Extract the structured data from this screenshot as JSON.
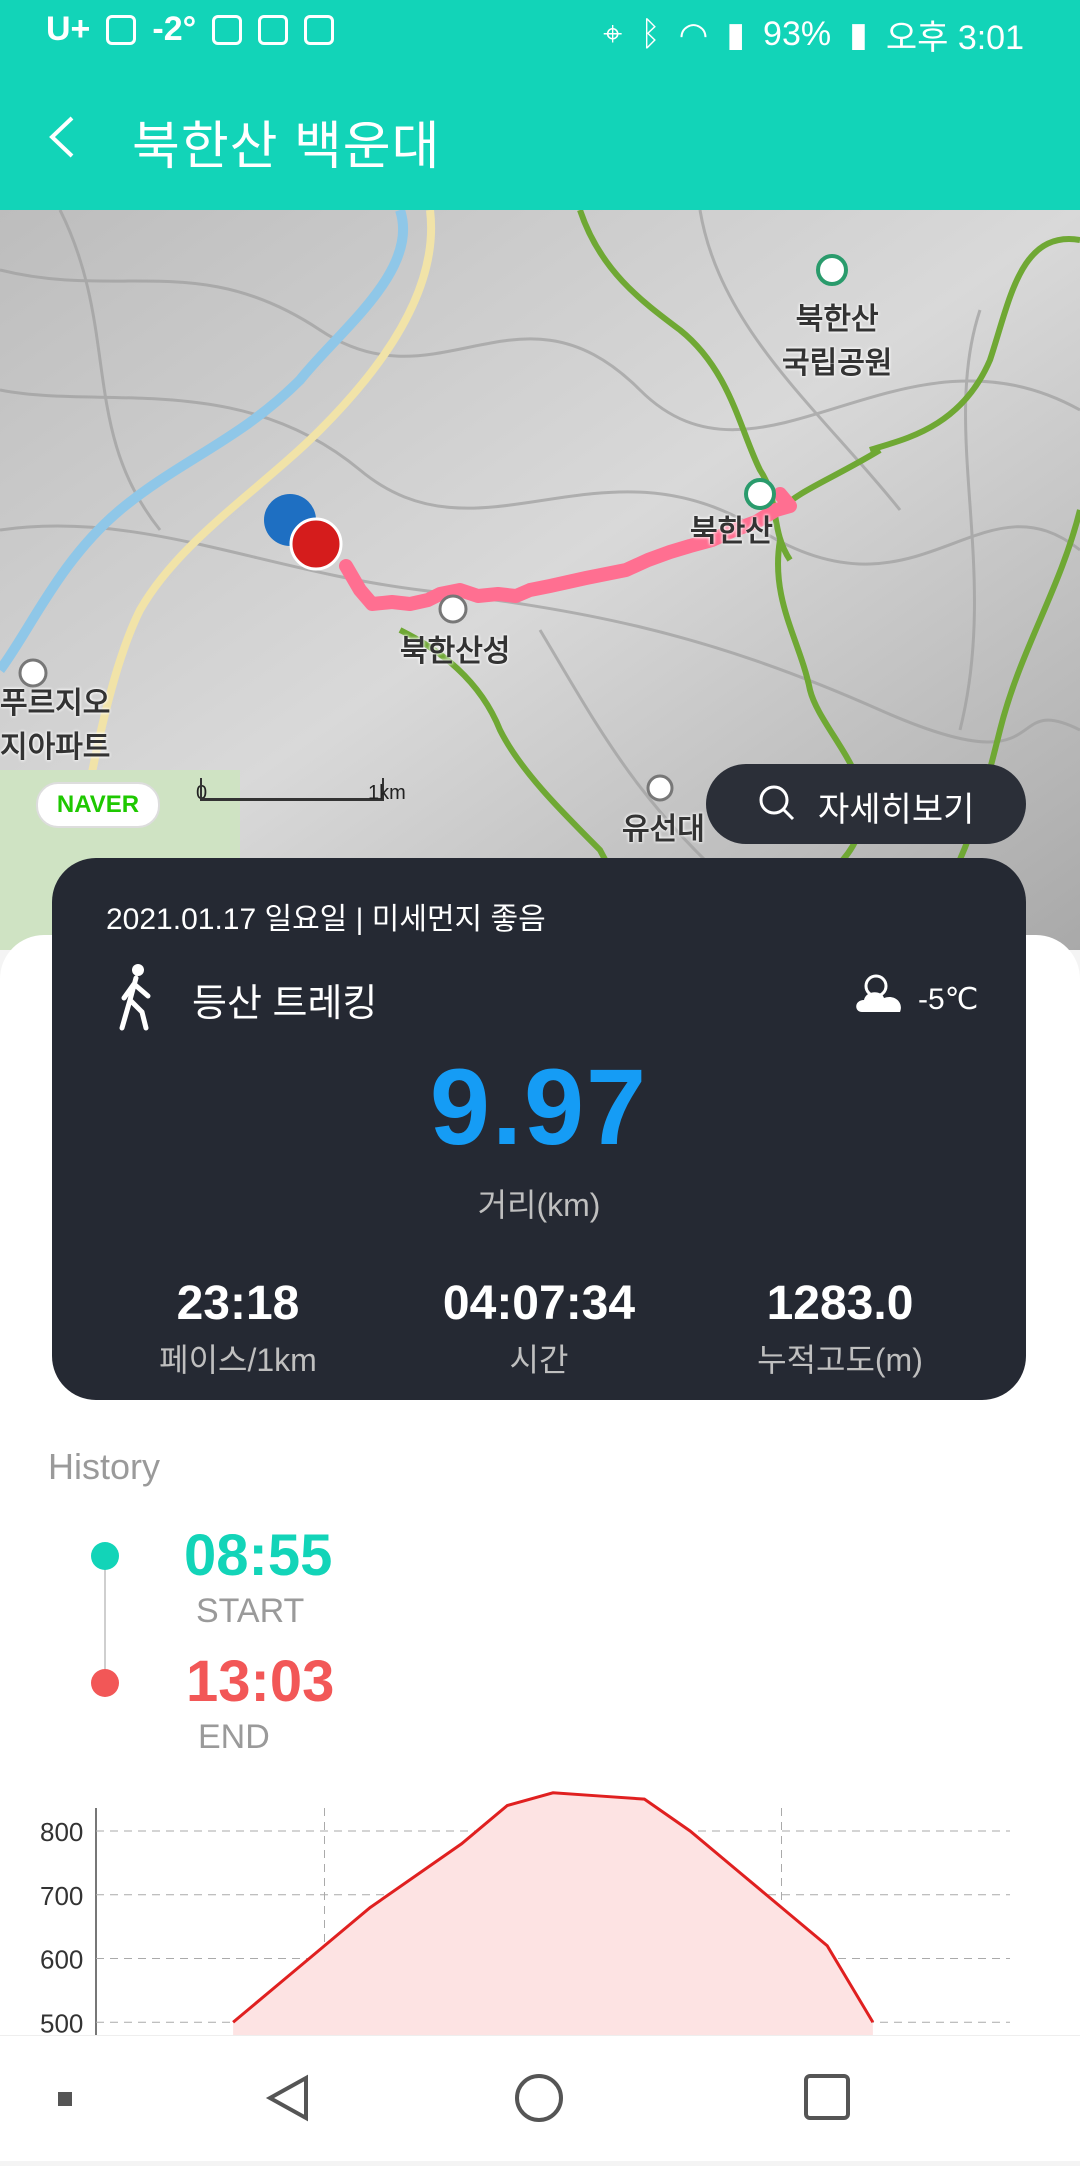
{
  "status_bar": {
    "carrier": "U+",
    "temperature": "-2°",
    "battery": "93%",
    "time": "오후 3:01"
  },
  "app_bar": {
    "title": "북한산 백운대",
    "back_icon": "chevron-left-icon"
  },
  "map": {
    "labels": {
      "park": "북한산\n국립공원",
      "peak": "북한산",
      "fortress": "북한산성",
      "yuseondae": "유선대",
      "apartment": "푸르지오\n지아파트"
    },
    "naver_logo": "NAVER",
    "scale_zero": "0",
    "scale_unit": "1km",
    "detail_button_label": "자세히보기",
    "route_color": "#ff6f91",
    "start_marker_color": "#1e6fc2",
    "end_marker_color": "#d51c1c"
  },
  "summary": {
    "date_line": "2021.01.17 일요일 | 미세먼지 좋음",
    "activity": "등산 트레킹",
    "temperature": "-5℃",
    "distance": "9.97",
    "distance_label": "거리(km)",
    "stats": [
      {
        "value": "23:18",
        "label": "페이스/1km"
      },
      {
        "value": "04:07:34",
        "label": "시간"
      },
      {
        "value": "1283.0",
        "label": "누적고도(m)"
      }
    ]
  },
  "history": {
    "heading": "History",
    "start_time": "08:55",
    "start_label": "START",
    "end_time": "13:03",
    "end_label": "END"
  },
  "chart_data": {
    "type": "area",
    "title": "",
    "xlabel": "",
    "ylabel": "",
    "y_ticks": [
      "800",
      "700",
      "600",
      "500"
    ],
    "ylim": [
      500,
      860
    ],
    "series": [
      {
        "color": "#e02020",
        "x": [
          0.0,
          0.05,
          0.1,
          0.15,
          0.2,
          0.25,
          0.3,
          0.35,
          0.4,
          0.45,
          0.5,
          0.55,
          0.6,
          0.65,
          0.7
        ],
        "values": [
          500,
          560,
          620,
          680,
          730,
          780,
          840,
          860,
          855,
          850,
          800,
          740,
          680,
          620,
          500
        ]
      }
    ],
    "grid": true
  },
  "nav_bar": {
    "items": [
      "square-small-icon",
      "back-triangle-icon",
      "home-circle-icon",
      "recents-square-icon"
    ]
  },
  "colors": {
    "accent": "#12d4b8",
    "card_bg": "#252933",
    "distance_blue": "#159cf5",
    "end_red": "#f25757"
  }
}
